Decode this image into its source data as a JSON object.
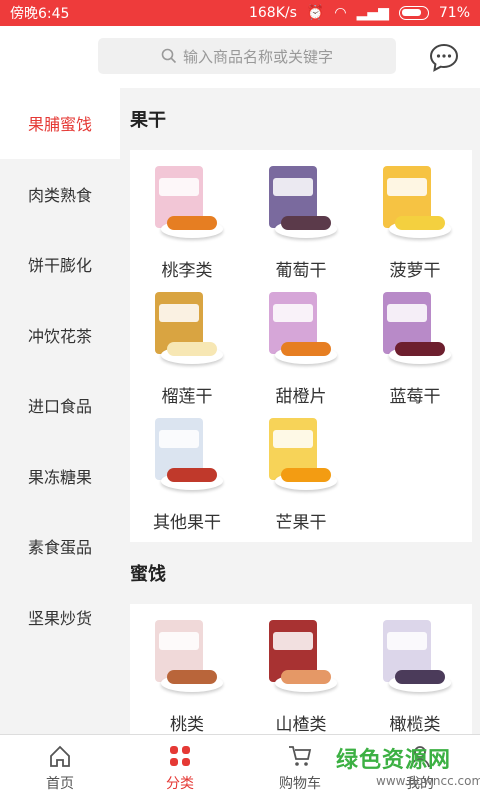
{
  "status": {
    "time": "傍晚6:45",
    "speed": "168K/s",
    "battery": "71%"
  },
  "search": {
    "placeholder": "输入商品名称或关键字"
  },
  "sidebar": {
    "items": [
      {
        "label": "果脯蜜饯",
        "active": true
      },
      {
        "label": "肉类熟食"
      },
      {
        "label": "饼干膨化"
      },
      {
        "label": "冲饮花茶"
      },
      {
        "label": "进口食品"
      },
      {
        "label": "果冻糖果"
      },
      {
        "label": "素食蛋品"
      },
      {
        "label": "坚果炒货"
      }
    ]
  },
  "sections": [
    {
      "title": "果干",
      "items": [
        {
          "label": "桃李类",
          "bag": "#f2c6d6",
          "food": "#e67e22"
        },
        {
          "label": "葡萄干",
          "bag": "#7a6a9e",
          "food": "#5b3a4a"
        },
        {
          "label": "菠萝干",
          "bag": "#f6c343",
          "food": "#f4d03f"
        },
        {
          "label": "榴莲干",
          "bag": "#d9a441",
          "food": "#f7e7b4"
        },
        {
          "label": "甜橙片",
          "bag": "#d6a6d8",
          "food": "#e67e22"
        },
        {
          "label": "蓝莓干",
          "bag": "#b88ac8",
          "food": "#6d1f2e"
        },
        {
          "label": "其他果干",
          "bag": "#dbe4f0",
          "food": "#c0392b"
        },
        {
          "label": "芒果干",
          "bag": "#f7d358",
          "food": "#f39c12"
        }
      ]
    },
    {
      "title": "蜜饯",
      "items": [
        {
          "label": "桃类",
          "bag": "#f0d9d9",
          "food": "#b9653a"
        },
        {
          "label": "山楂类",
          "bag": "#a83232",
          "food": "#e59866"
        },
        {
          "label": "橄榄类",
          "bag": "#dcd6ea",
          "food": "#4b3b5a"
        }
      ]
    }
  ],
  "tabs": [
    {
      "label": "首页",
      "icon": "home-icon"
    },
    {
      "label": "分类",
      "icon": "category-icon",
      "active": true
    },
    {
      "label": "购物车",
      "icon": "cart-icon"
    },
    {
      "label": "我的",
      "icon": "user-icon"
    }
  ],
  "watermark": {
    "big": "绿色资源网",
    "small": "www.downcc.com"
  },
  "colors": {
    "accent": "#e53935",
    "statusbar": "#ee3b3b"
  }
}
